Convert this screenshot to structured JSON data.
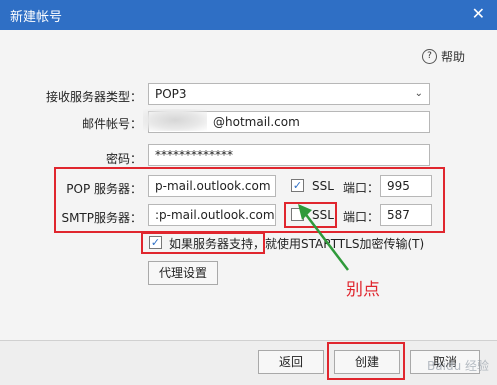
{
  "window": {
    "title": "新建帐号",
    "close_glyph": "✕"
  },
  "help": {
    "icon_glyph": "?",
    "label": "帮助"
  },
  "form": {
    "server_type_label": "接收服务器类型：",
    "server_type_value": "POP3",
    "account_label": "邮件帐号：",
    "account_value_visible": "@hotmail.com",
    "password_label": "密码：",
    "password_value": "*************",
    "pop_label": "POP 服务器：",
    "pop_value": "p-mail.outlook.com",
    "pop_ssl_label": "SSL",
    "pop_ssl_checked": true,
    "pop_port_label": "端口：",
    "pop_port_value": "995",
    "smtp_label": "SMTP服务器：",
    "smtp_value": ":p-mail.outlook.com",
    "smtp_ssl_label": "SSL",
    "smtp_ssl_checked": false,
    "smtp_port_label": "端口：",
    "smtp_port_value": "587",
    "starttls_label": "如果服务器支持，就使用STARTTLS加密传输(T)",
    "starttls_checked": true,
    "proxy_button": "代理设置"
  },
  "annotation": {
    "text": "别点"
  },
  "buttons": {
    "back": "返回",
    "create": "创建",
    "cancel": "取消"
  },
  "watermark": "Baidu 经验",
  "colors": {
    "titlebar": "#2f6fc5",
    "annotation": "#e0262e",
    "arrow": "#2f9a3a"
  }
}
